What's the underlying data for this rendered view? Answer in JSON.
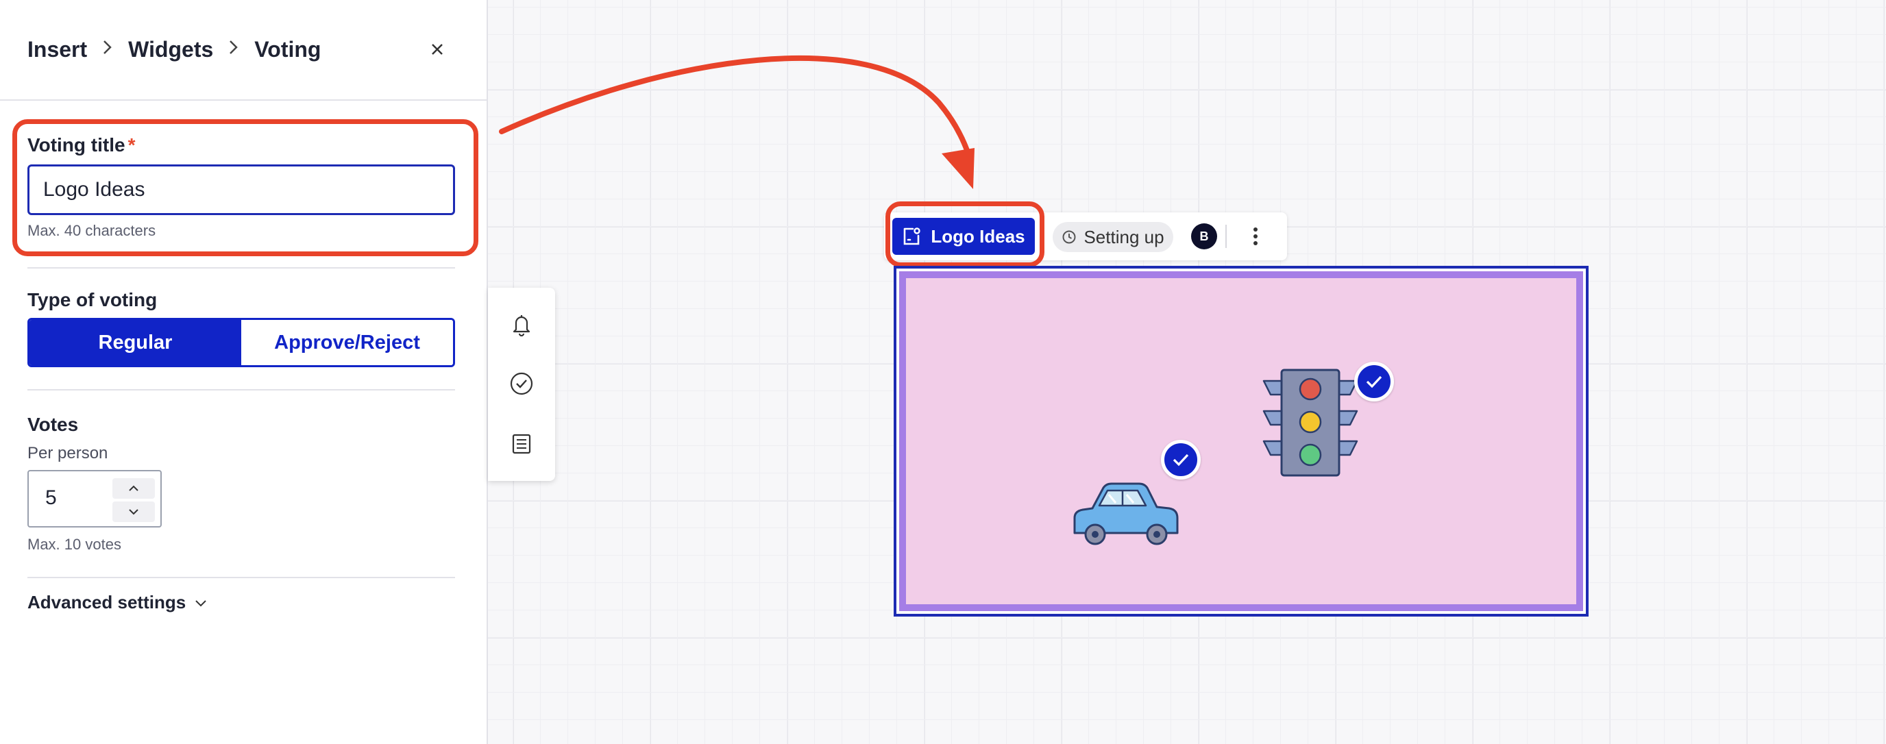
{
  "breadcrumb": [
    "Insert",
    "Widgets",
    "Voting"
  ],
  "close_label": "×",
  "voting_title": {
    "label": "Voting title",
    "required_mark": "*",
    "value": "Logo Ideas",
    "hint": "Max. 40 characters"
  },
  "type_of_voting": {
    "label": "Type of voting",
    "options": [
      "Regular",
      "Approve/Reject"
    ],
    "selected": "Regular"
  },
  "votes": {
    "label": "Votes",
    "sublabel": "Per person",
    "value": "5",
    "hint": "Max. 10 votes"
  },
  "advanced_settings_label": "Advanced settings",
  "side_toolbar": {
    "icons": [
      "bell-icon",
      "check-circle-icon",
      "list-icon"
    ]
  },
  "widget_bar": {
    "title": "Logo Ideas",
    "status": "Setting up",
    "avatar_initial": "B"
  },
  "colors": {
    "primary": "#1124c7",
    "highlight": "#e8432a",
    "frame_border": "#a57ee6",
    "frame_fill": "#f2cde8"
  }
}
